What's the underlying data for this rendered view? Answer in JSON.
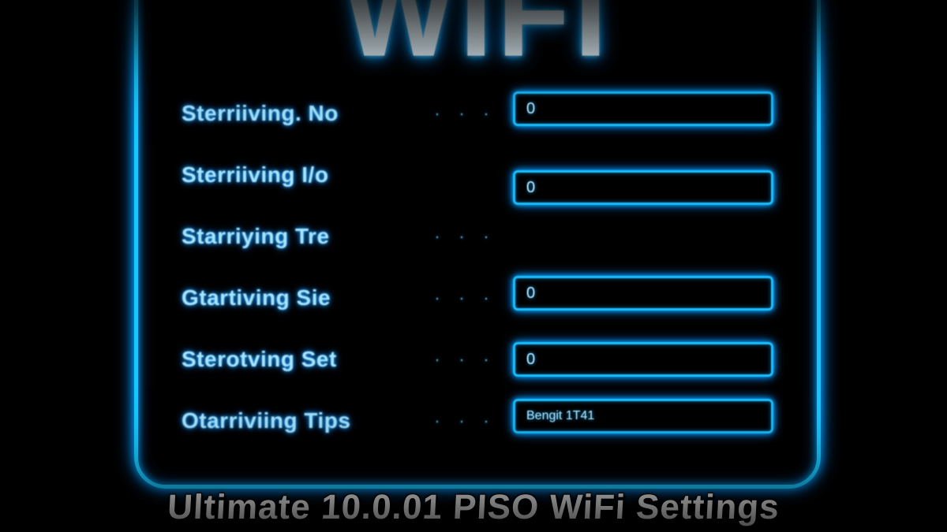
{
  "panel": {
    "title": "WIFI",
    "caption": "Ultimate 10.0.01 PISO WiFi Settings"
  },
  "rows": [
    {
      "label": "Sterriiving. No",
      "dots": "· · ·",
      "value": "0"
    },
    {
      "label": "Sterriiving I/o",
      "dots": "",
      "value": "0"
    },
    {
      "label": "Starriying Tre",
      "dots": "· · ·",
      "value": ""
    },
    {
      "label": "Gtartiving Sie",
      "dots": "· · ·",
      "value": "0"
    },
    {
      "label": "Sterotving Set",
      "dots": "· · ·",
      "value": "0"
    },
    {
      "label": "Otarriviing Tips",
      "dots": "· · ·",
      "value": "Bengit 1T41"
    }
  ],
  "colors": {
    "neon": "#18c8ff",
    "glow": "#0a88ff",
    "text": "#bce9ff"
  }
}
